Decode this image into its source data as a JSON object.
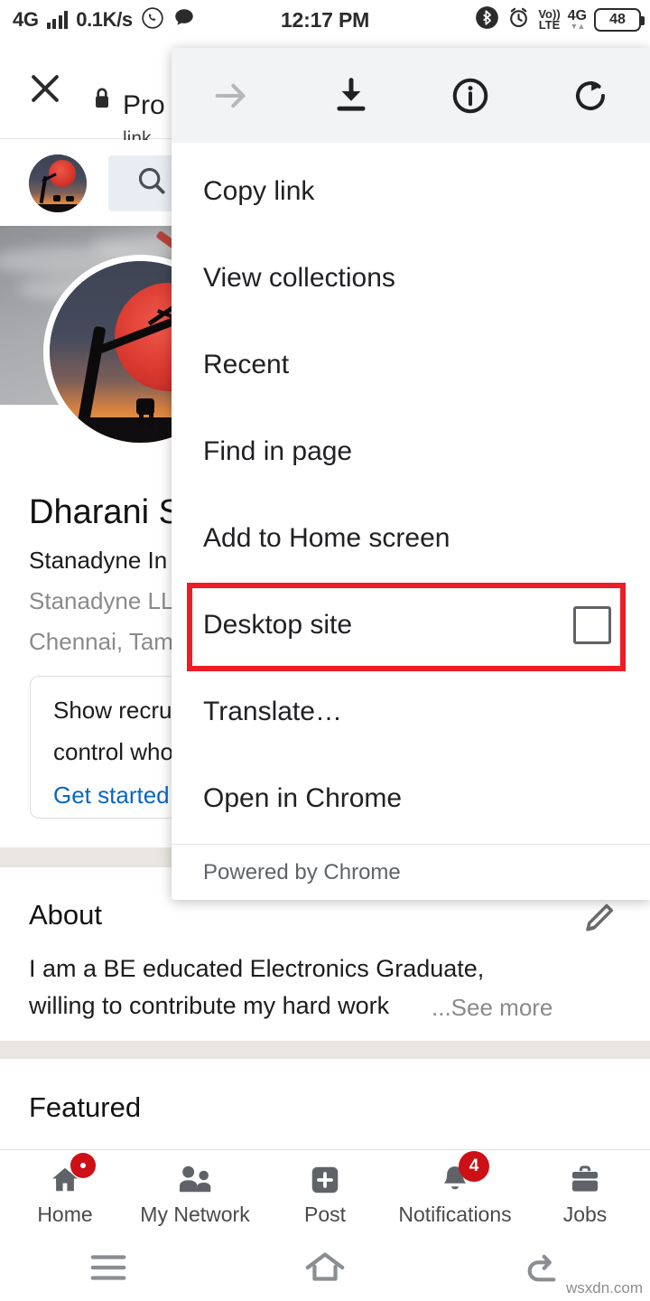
{
  "status_bar": {
    "network_type": "4G",
    "data_speed": "0.1K/s",
    "whatsapp_icon": "whatsapp-icon",
    "message_icon": "message-bubble-icon",
    "time": "12:17 PM",
    "bluetooth_icon": "bluetooth-icon",
    "alarm_icon": "alarm-clock-icon",
    "volte_line1": "Vo))",
    "volte_line2": "LTE",
    "mobile_net": "4G",
    "battery_level": "48"
  },
  "custom_tab": {
    "close_icon": "close-icon",
    "lock_icon": "lock-icon",
    "title": "Pro",
    "subtitle": "link"
  },
  "linkedin": {
    "top_row": {
      "avatar": "profile-avatar",
      "search_icon": "search-icon"
    },
    "profile": {
      "name": "Dharani S",
      "headline": "Stanadyne In",
      "company": "Stanadyne LL",
      "location": "Chennai, Tam"
    },
    "recruiter_card": {
      "line1": "Show recru",
      "line2": "control who",
      "cta": "Get started"
    },
    "about": {
      "heading": "About",
      "edit_icon": "pencil-edit-icon",
      "line1": "I am a BE educated Electronics Graduate,",
      "line2": "willing to contribute my hard work",
      "see_more": "...See more"
    },
    "featured": {
      "heading": "Featured"
    },
    "bottom_nav": [
      {
        "label": "Home",
        "icon": "home-icon",
        "badge": "",
        "badge_type": "dot"
      },
      {
        "label": "My Network",
        "icon": "people-icon",
        "badge": "",
        "badge_type": "none"
      },
      {
        "label": "Post",
        "icon": "plus-square-icon",
        "badge": "",
        "badge_type": "none"
      },
      {
        "label": "Notifications",
        "icon": "bell-icon",
        "badge": "4",
        "badge_type": "num"
      },
      {
        "label": "Jobs",
        "icon": "briefcase-icon",
        "badge": "",
        "badge_type": "none"
      }
    ]
  },
  "chrome_menu": {
    "toolbar_icons": [
      {
        "name": "forward-arrow-icon",
        "disabled": true
      },
      {
        "name": "download-icon",
        "disabled": false
      },
      {
        "name": "page-info-icon",
        "disabled": false
      },
      {
        "name": "reload-icon",
        "disabled": false
      }
    ],
    "items": [
      {
        "label": "Copy link",
        "has_checkbox": false
      },
      {
        "label": "View collections",
        "has_checkbox": false
      },
      {
        "label": "Recent",
        "has_checkbox": false
      },
      {
        "label": "Find in page",
        "has_checkbox": false
      },
      {
        "label": "Add to Home screen",
        "has_checkbox": false
      },
      {
        "label": "Desktop site",
        "has_checkbox": true,
        "checked": false,
        "highlighted": true
      },
      {
        "label": "Translate…",
        "has_checkbox": false
      },
      {
        "label": "Open in Chrome",
        "has_checkbox": false
      }
    ],
    "footer": "Powered by Chrome",
    "highlight_color": "#ee1c25"
  },
  "android_nav": {
    "menu_icon": "hamburger-menu-icon",
    "home_icon": "home-outline-icon",
    "back_icon": "back-arrow-icon"
  },
  "watermark": "wsxdn.com"
}
